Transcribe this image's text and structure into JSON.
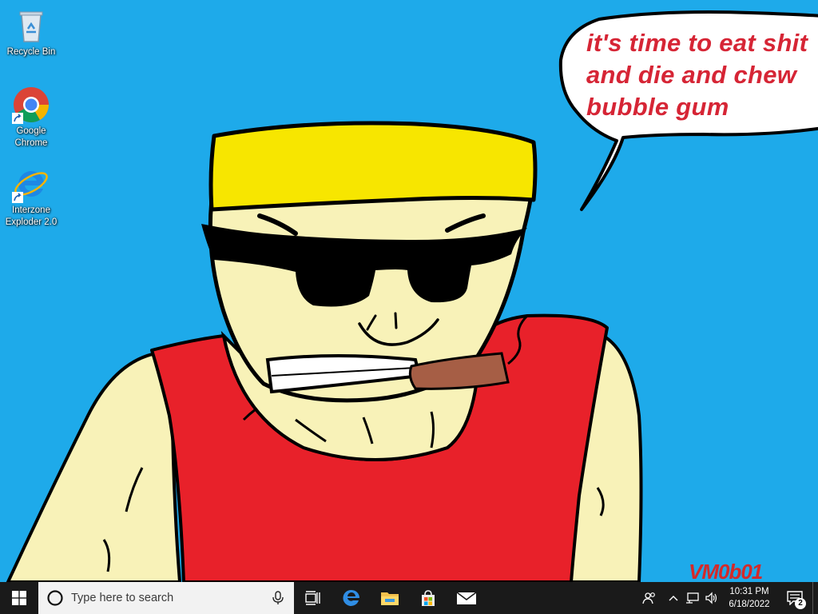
{
  "wallpaper": {
    "speech_text": "it's time to eat shit\nand die and chew\nbubble gum",
    "signature": "VM0b01",
    "colors": {
      "background": "#1eaaea",
      "speech_text": "#d62535",
      "signature": "#d42a2a",
      "hair": "#f7e600",
      "skin": "#f8f2b8",
      "shirt": "#e8212a",
      "cigar": "#a65e45"
    }
  },
  "desktop_icons": [
    {
      "label": "Recycle Bin",
      "icon": "recycle-bin-icon"
    },
    {
      "label": "Google\nChrome",
      "icon": "chrome-icon"
    },
    {
      "label": "Interzone\nExploder 2.0",
      "icon": "ie-icon"
    }
  ],
  "taskbar": {
    "search_placeholder": "Type here to search",
    "pinned": [
      "task-view-icon",
      "edge-icon",
      "file-explorer-icon",
      "store-icon",
      "mail-icon"
    ],
    "clock_time": "10:31 PM",
    "clock_date": "6/18/2022",
    "notification_count": "2",
    "colors": {
      "bar": "#1a1a1a",
      "search": "#f2f2f2"
    }
  }
}
